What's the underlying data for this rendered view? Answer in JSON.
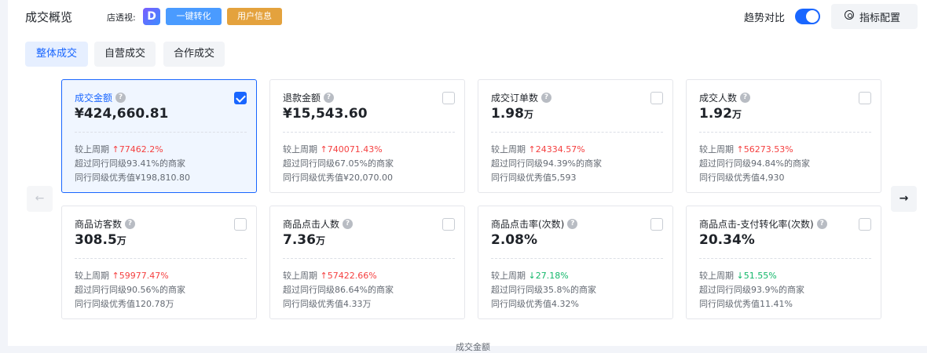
{
  "header": {
    "title": "成交概览",
    "store_label": "店透视:",
    "store_logo_letter": "D",
    "btn_convert": "一键转化",
    "btn_userinfo": "用户信息",
    "trend_label": "趋势对比",
    "trend_on": true,
    "metric_config": "指标配置"
  },
  "tabs": [
    {
      "label": "整体成交",
      "active": true
    },
    {
      "label": "自营成交",
      "active": false
    },
    {
      "label": "合作成交",
      "active": false
    }
  ],
  "cards": [
    {
      "name": "成交金额",
      "value": "¥424,660.81",
      "unit": "",
      "checked": true,
      "compare_label": "较上周期",
      "dir": "up",
      "change": "77462.2%",
      "exceed": "超过同行同级93.41%的商家",
      "excellent": "同行同级优秀值¥198,810.80"
    },
    {
      "name": "退款金额",
      "value": "¥15,543.60",
      "unit": "",
      "checked": false,
      "compare_label": "较上周期",
      "dir": "up",
      "change": "740071.43%",
      "exceed": "超过同行同级67.05%的商家",
      "excellent": "同行同级优秀值¥20,070.00"
    },
    {
      "name": "成交订单数",
      "value": "1.98",
      "unit": "万",
      "checked": false,
      "compare_label": "较上周期",
      "dir": "up",
      "change": "24334.57%",
      "exceed": "超过同行同级94.39%的商家",
      "excellent": "同行同级优秀值5,593"
    },
    {
      "name": "成交人数",
      "value": "1.92",
      "unit": "万",
      "checked": false,
      "compare_label": "较上周期",
      "dir": "up",
      "change": "56273.53%",
      "exceed": "超过同行同级94.84%的商家",
      "excellent": "同行同级优秀值4,930"
    },
    {
      "name": "商品访客数",
      "value": "308.5",
      "unit": "万",
      "checked": false,
      "compare_label": "较上周期",
      "dir": "up",
      "change": "59977.47%",
      "exceed": "超过同行同级90.56%的商家",
      "excellent": "同行同级优秀值120.78万"
    },
    {
      "name": "商品点击人数",
      "value": "7.36",
      "unit": "万",
      "checked": false,
      "compare_label": "较上周期",
      "dir": "up",
      "change": "57422.66%",
      "exceed": "超过同行同级86.64%的商家",
      "excellent": "同行同级优秀值4.33万"
    },
    {
      "name": "商品点击率(次数)",
      "value": "2.08%",
      "unit": "",
      "checked": false,
      "compare_label": "较上周期",
      "dir": "down",
      "change": "27.18%",
      "exceed": "超过同行同级35.8%的商家",
      "excellent": "同行同级优秀值4.32%"
    },
    {
      "name": "商品点击-支付转化率(次数)",
      "value": "20.34%",
      "unit": "",
      "checked": false,
      "compare_label": "较上周期",
      "dir": "down",
      "change": "51.55%",
      "exceed": "超过同行同级93.9%的商家",
      "excellent": "同行同级优秀值11.41%"
    }
  ],
  "icons": {
    "question": "?",
    "up_arrow": "↑",
    "down_arrow": "↓",
    "prev": "←",
    "next": "→"
  },
  "bottom_hint": "成交金额",
  "colors": {
    "accent": "#1966ff",
    "up": "#f53f3f",
    "down": "#12b76a",
    "convert_btn": "#4a9bff",
    "userinfo_btn": "#e4a23d"
  }
}
